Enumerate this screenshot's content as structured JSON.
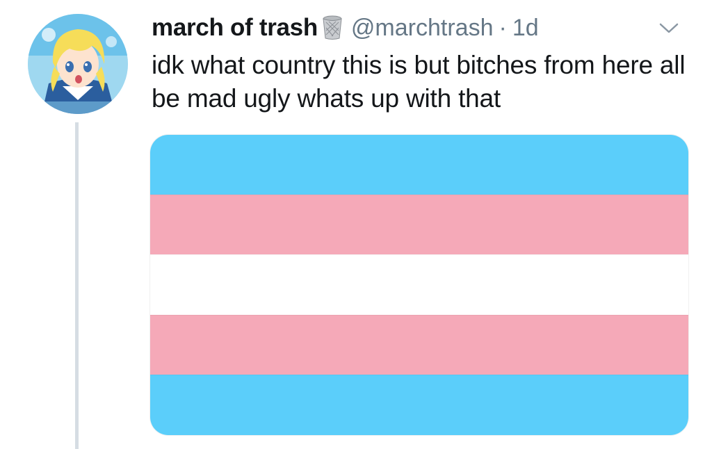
{
  "tweet": {
    "display_name": "march of trash",
    "handle": "@marchtrash",
    "separator": "·",
    "time": "1d",
    "text": "idk what country this is but bitches from here all be mad ugly whats up with that"
  },
  "icons": {
    "name_emoji": "wastebasket-icon",
    "menu": "chevron-down-icon"
  },
  "flag": {
    "stripes": [
      "#5bcefa",
      "#f5a9b8",
      "#ffffff",
      "#f5a9b8",
      "#5bcefa"
    ]
  },
  "colors": {
    "text": "#14171a",
    "secondary": "#657786",
    "thread_line": "#d6dde3"
  }
}
